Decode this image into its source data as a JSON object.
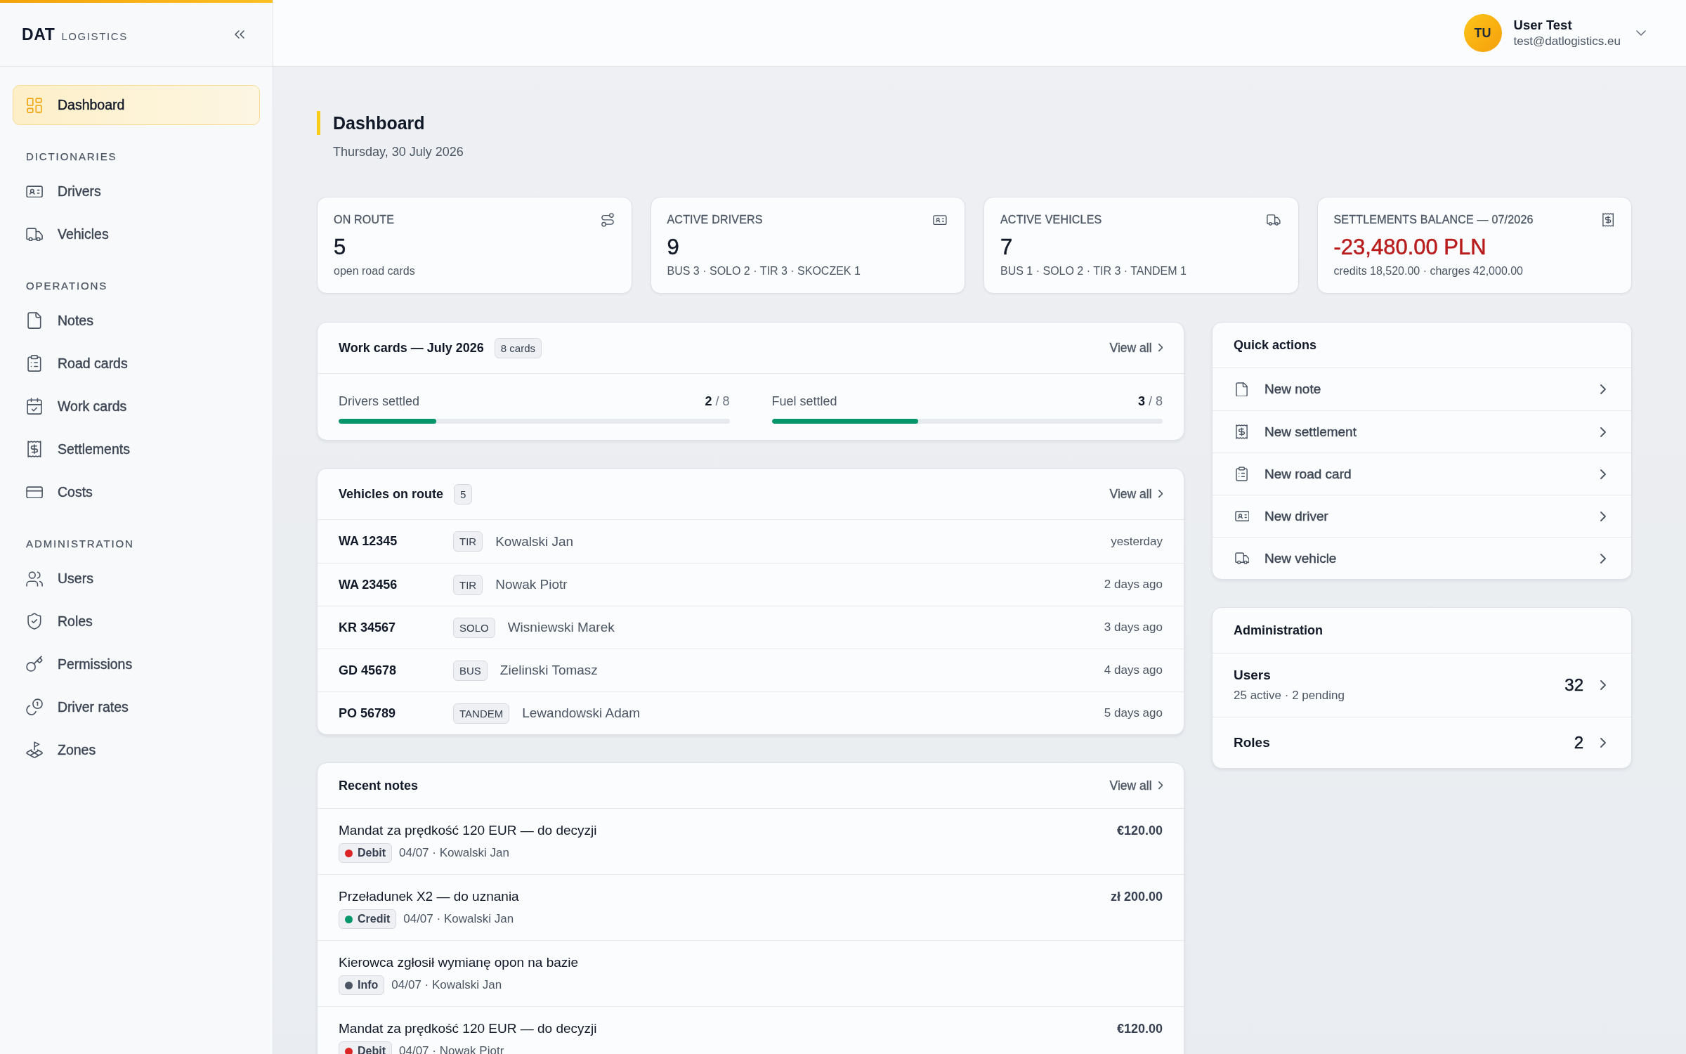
{
  "sidebar": {
    "brand": "DAT",
    "brand_suffix": "LOGISTICS",
    "items": [
      {
        "label": "Dashboard",
        "selected": true
      }
    ],
    "sections": [
      {
        "title": "DICTIONARIES",
        "items": [
          {
            "label": "Drivers",
            "selected": false
          },
          {
            "label": "Vehicles",
            "selected": false
          }
        ]
      },
      {
        "title": "OPERATIONS",
        "items": [
          {
            "label": "Notes",
            "selected": false
          },
          {
            "label": "Road cards",
            "selected": false
          },
          {
            "label": "Work cards",
            "selected": false
          },
          {
            "label": "Settlements",
            "selected": false
          },
          {
            "label": "Costs",
            "selected": false
          }
        ]
      },
      {
        "title": "ADMINISTRATION",
        "items": [
          {
            "label": "Users",
            "selected": false
          },
          {
            "label": "Roles",
            "selected": false
          },
          {
            "label": "Permissions",
            "selected": false
          },
          {
            "label": "Driver rates",
            "selected": false
          },
          {
            "label": "Zones",
            "selected": false
          }
        ]
      }
    ]
  },
  "top_bar": {
    "user": {
      "initials": "TU",
      "name": "User Test",
      "email": "test@datlogistics.eu"
    }
  },
  "page": {
    "title": "Dashboard",
    "date": "Thursday, 30 July 2026"
  },
  "stats": [
    {
      "label": "ON ROUTE",
      "value": "5",
      "detail": "open road cards",
      "negative": false
    },
    {
      "label": "ACTIVE DRIVERS",
      "value": "9",
      "detail": "BUS 3 · SOLO 2 · TIR 3 · SKOCZEK 1",
      "negative": false
    },
    {
      "label": "ACTIVE VEHICLES",
      "value": "7",
      "detail": "BUS 1 · SOLO 2 · TIR 3 · TANDEM 1",
      "negative": false
    },
    {
      "label": "SETTLEMENTS BALANCE — 07/2026",
      "value": "-23,480.00 PLN",
      "detail": "credits 18,520.00 · charges 42,000.00",
      "negative": true
    }
  ],
  "work_cards": {
    "title": "Work cards — July 2026",
    "badge": "8 cards",
    "link": "View all",
    "progress": [
      {
        "label": "Drivers settled",
        "count": "**2** / 8",
        "level": 0.25
      },
      {
        "label": "Fuel settled",
        "count": "**3** / 8",
        "level": 0.375
      }
    ]
  },
  "vehicles_on_route": {
    "title": "Vehicles on route",
    "count": "5",
    "link": "View all",
    "rows": [
      {
        "plate": "WA 12345",
        "type": "TIR",
        "driver": "Kowalski Jan",
        "time": "yesterday"
      },
      {
        "plate": "WA 23456",
        "type": "TIR",
        "driver": "Nowak Piotr",
        "time": "2 days ago"
      },
      {
        "plate": "KR 34567",
        "type": "SOLO",
        "driver": "Wisniewski Marek",
        "time": "3 days ago"
      },
      {
        "plate": "GD 45678",
        "type": "BUS",
        "driver": "Zielinski Tomasz",
        "time": "4 days ago"
      },
      {
        "plate": "PO 56789",
        "type": "TANDEM",
        "driver": "Lewandowski Adam",
        "time": "5 days ago"
      }
    ]
  },
  "recent_notes": {
    "title": "Recent notes",
    "link": "View all",
    "rows": [
      {
        "title": "Mandat za prędkość 120 EUR — do decyzji",
        "tag": "Debit",
        "color": "#dc2626",
        "meta": "04/07 · Kowalski Jan",
        "amount": "€120.00"
      },
      {
        "title": "Przeładunek X2 — do uznania",
        "tag": "Credit",
        "color": "#059669",
        "meta": "04/07 · Kowalski Jan",
        "amount": "zł 200.00"
      },
      {
        "title": "Kierowca zgłosił wymianę opon na bazie",
        "tag": "Info",
        "color": "#4b5563",
        "meta": "04/07 · Kowalski Jan"
      },
      {
        "title": "Mandat za prędkość 120 EUR — do decyzji",
        "tag": "Debit",
        "color": "#dc2626",
        "meta": "04/07 · Nowak Piotr",
        "amount": "€120.00"
      }
    ]
  },
  "quick_actions": {
    "title": "Quick actions",
    "items": [
      {
        "label": "New note"
      },
      {
        "label": "New settlement"
      },
      {
        "label": "New road card"
      },
      {
        "label": "New driver"
      },
      {
        "label": "New vehicle"
      }
    ]
  },
  "administration": {
    "title": "Administration",
    "items": [
      {
        "label": "Users",
        "detail": "25 active · 2 pending",
        "count": "32"
      },
      {
        "label": "Roles",
        "count": "2"
      }
    ]
  }
}
